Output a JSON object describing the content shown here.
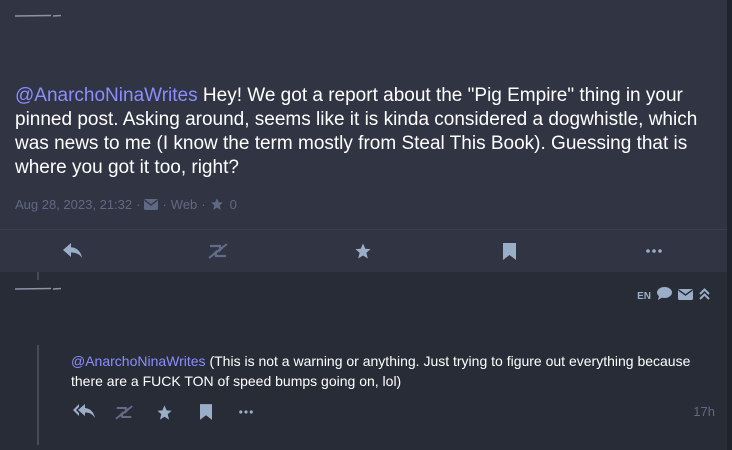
{
  "main_status": {
    "content_mention": "@AnarchoNinaWrites",
    "content_text": " Hey! We got a report about the \"Pig Empire\" thing in your pinned post. Asking around, seems like it is kinda considered a dogwhistle, which was news to me (I know the term mostly from Steal This Book). Guessing that is where you got it too, right?",
    "timestamp": "Aug 28, 2023, 21:32",
    "separator": "·",
    "app": "Web",
    "favourite_count": "0"
  },
  "reply": {
    "language": "EN",
    "content_mention": "@AnarchoNinaWrites",
    "content_text": " (This is not a warning or anything. Just trying to figure out everything because there are a FUCK TON of speed bumps going on, lol)",
    "relative_time": "17h"
  },
  "colors": {
    "background": "#282c37",
    "status_background": "#313543",
    "text": "#ffffff",
    "mention": "#8c8dff",
    "muted": "#606984",
    "icon": "#9baec8"
  }
}
